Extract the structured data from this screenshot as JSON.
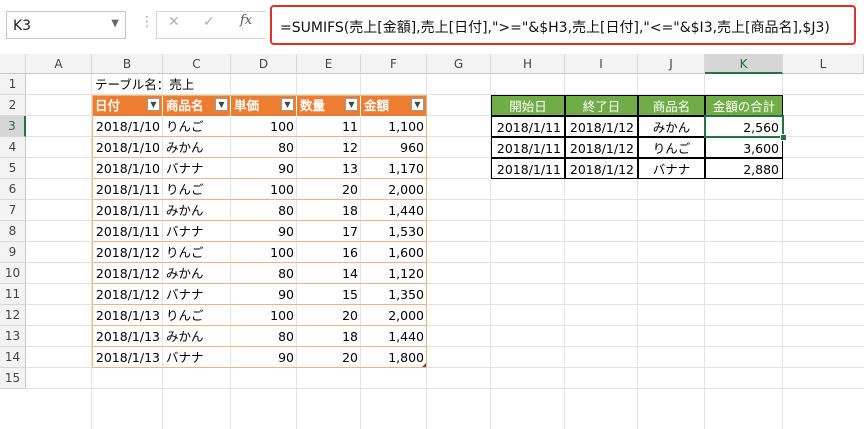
{
  "name_box": "K3",
  "formula": "=SUMIFS(売上[金額],売上[日付],\">=\"&$H3,売上[日付],\"<=\"&$I3,売上[商品名],$J3)",
  "columns": [
    "A",
    "B",
    "C",
    "D",
    "E",
    "F",
    "G",
    "H",
    "I",
    "J",
    "K",
    "L"
  ],
  "rows": [
    "1",
    "2",
    "3",
    "4",
    "5",
    "6",
    "7",
    "8",
    "9",
    "10",
    "11",
    "12",
    "13",
    "14",
    "15"
  ],
  "table_caption": "テーブル名：売上",
  "table": {
    "headers": [
      "日付",
      "商品名",
      "単価",
      "数量",
      "金額"
    ],
    "rows": [
      [
        "2018/1/10",
        "りんご",
        "100",
        "11",
        "1,100"
      ],
      [
        "2018/1/10",
        "みかん",
        "80",
        "12",
        "960"
      ],
      [
        "2018/1/10",
        "バナナ",
        "90",
        "13",
        "1,170"
      ],
      [
        "2018/1/11",
        "りんご",
        "100",
        "20",
        "2,000"
      ],
      [
        "2018/1/11",
        "みかん",
        "80",
        "18",
        "1,440"
      ],
      [
        "2018/1/11",
        "バナナ",
        "90",
        "17",
        "1,530"
      ],
      [
        "2018/1/12",
        "りんご",
        "100",
        "16",
        "1,600"
      ],
      [
        "2018/1/12",
        "みかん",
        "80",
        "14",
        "1,120"
      ],
      [
        "2018/1/12",
        "バナナ",
        "90",
        "15",
        "1,350"
      ],
      [
        "2018/1/13",
        "りんご",
        "100",
        "20",
        "2,000"
      ],
      [
        "2018/1/13",
        "みかん",
        "80",
        "18",
        "1,440"
      ],
      [
        "2018/1/13",
        "バナナ",
        "90",
        "20",
        "1,800"
      ]
    ]
  },
  "criteria": {
    "headers": [
      "開始日",
      "終了日",
      "商品名",
      "金額の合計"
    ],
    "rows": [
      [
        "2018/1/11",
        "2018/1/12",
        "みかん",
        "2,560"
      ],
      [
        "2018/1/11",
        "2018/1/12",
        "りんご",
        "3,600"
      ],
      [
        "2018/1/11",
        "2018/1/12",
        "バナナ",
        "2,880"
      ]
    ]
  },
  "colors": {
    "table_header": "#ed7d31",
    "criteria_header": "#70ad47",
    "selection": "#217346",
    "formula_highlight": "#e0302a"
  }
}
